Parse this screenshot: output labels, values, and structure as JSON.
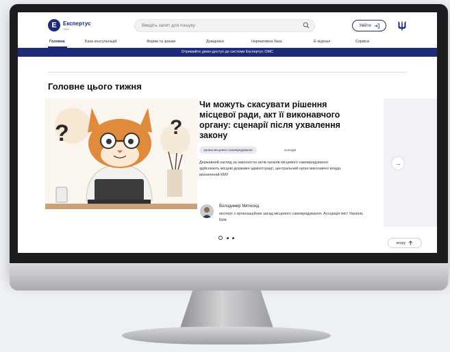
{
  "header": {
    "logo_letter": "Е",
    "brand": "Експертус",
    "brand_sub": "ОМС",
    "search_placeholder": "Введіть запит для пошуку",
    "login_label": "Увійти"
  },
  "nav": {
    "items": [
      "Головна",
      "База консультацій",
      "Форми та зразки",
      "Довідники",
      "Нормативна база",
      "Е-журнал",
      "Сервіси"
    ]
  },
  "banner": {
    "text": "Отримайте демо-доступ до системи Експертус ОМС"
  },
  "section": {
    "title": "Головне цього тижня"
  },
  "article": {
    "title": "Чи можуть скасувати рішення місцевої ради, акт її виконавчого органу: сценарії після ухвалення закону",
    "tag": "органи місцевого самоврядування",
    "date": "сьогодні",
    "summary": "Державний нагляд за законністю актів органів місцевого самоврядування здійснюють місцеві державні адміністрації, центральний орган виконавчої влади, визначений КМУ",
    "author_name": "Володимир Мяткохід",
    "author_role": "експерт з організаційних засад місцевого самоврядування, Асоціація міст України, Київ"
  },
  "carousel": {
    "next_symbol": "→",
    "active_index": 0,
    "count": 3
  },
  "footer": {
    "up_label": "вгору"
  },
  "colors": {
    "brand": "#1c2a77",
    "cat_fur": "#e08a3c",
    "background": "#eef1f4"
  }
}
